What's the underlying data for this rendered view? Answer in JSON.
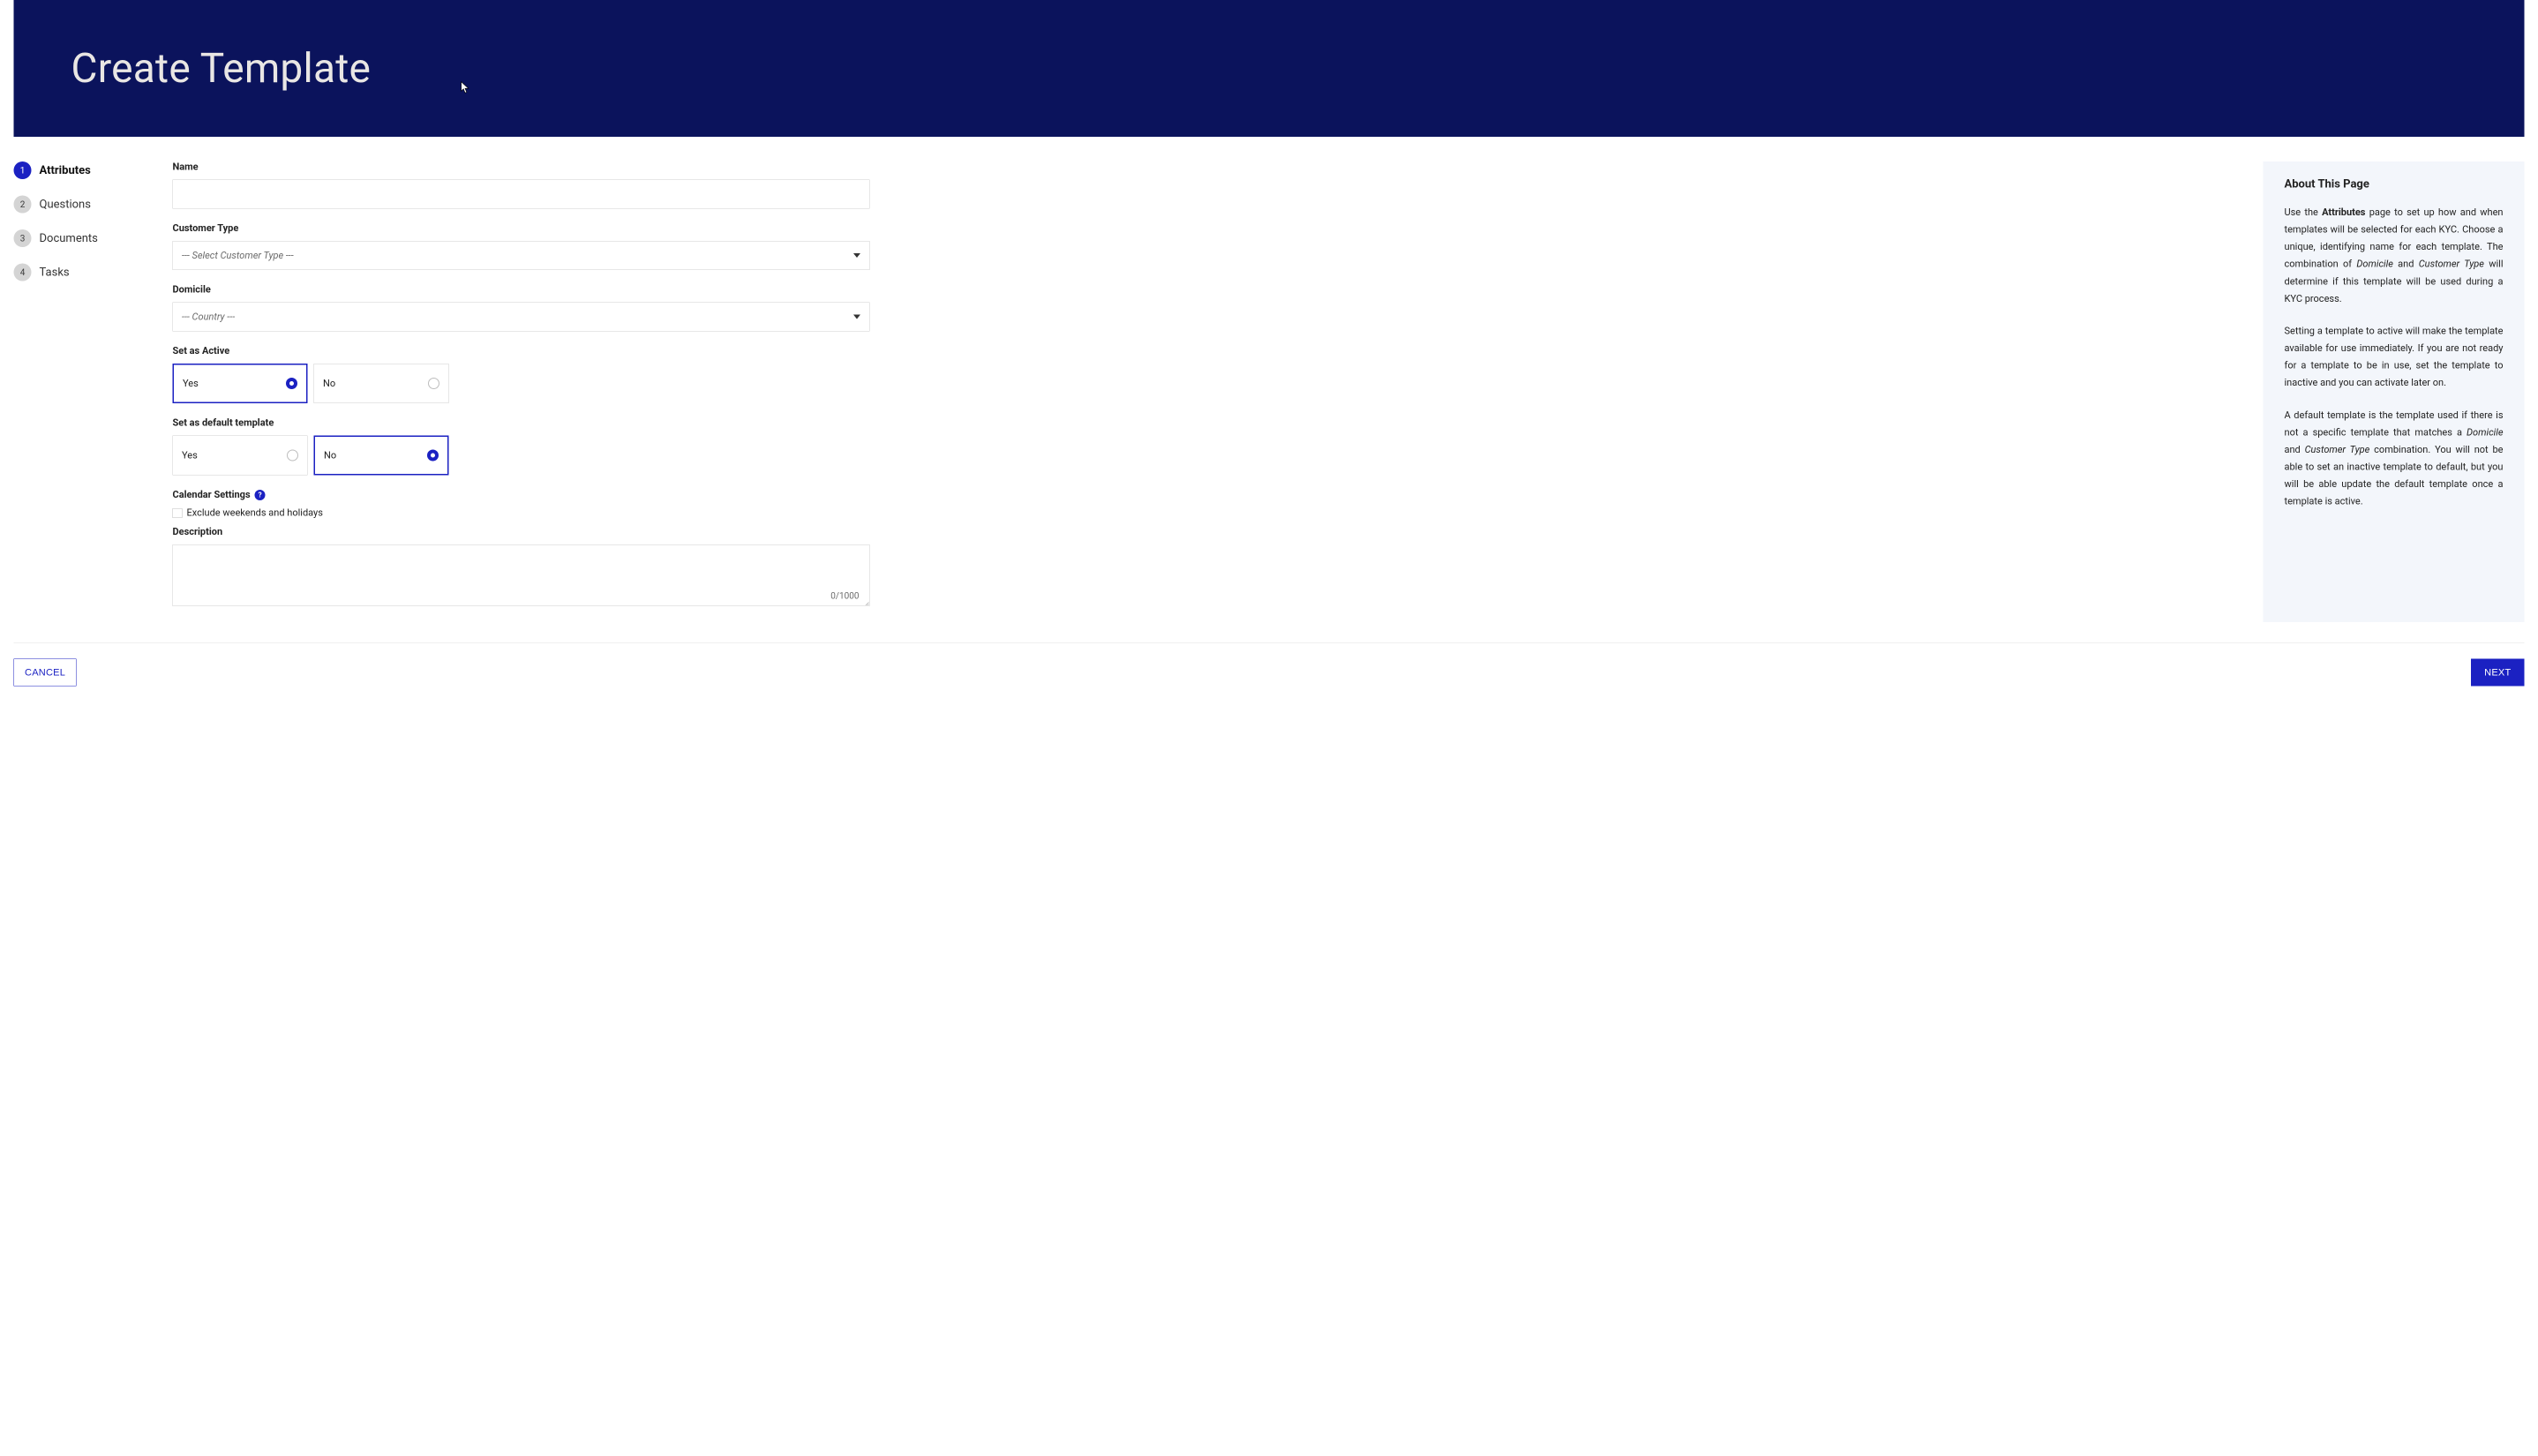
{
  "page_title": "Create Template",
  "stepper": [
    {
      "num": "1",
      "label": "Attributes",
      "active": true
    },
    {
      "num": "2",
      "label": "Questions",
      "active": false
    },
    {
      "num": "3",
      "label": "Documents",
      "active": false
    },
    {
      "num": "4",
      "label": "Tasks",
      "active": false
    }
  ],
  "form": {
    "name_label": "Name",
    "name_value": "",
    "customer_type_label": "Customer Type",
    "customer_type_placeholder": "--- Select Customer Type ---",
    "domicile_label": "Domicile",
    "domicile_placeholder": "--- Country ---",
    "set_active_label": "Set as Active",
    "set_active_options": {
      "yes": "Yes",
      "no": "No"
    },
    "set_active_value": "yes",
    "set_default_label": "Set as default template",
    "set_default_options": {
      "yes": "Yes",
      "no": "No"
    },
    "set_default_value": "no",
    "calendar_label": "Calendar Settings",
    "exclude_label": "Exclude weekends and holidays",
    "exclude_checked": false,
    "description_label": "Description",
    "description_value": "",
    "description_counter": "0/1000"
  },
  "info": {
    "title": "About This Page",
    "p1_pre": "Use the ",
    "p1_b1": "Attributes",
    "p1_mid": " page to set up how and when templates will be selected for each KYC. Choose a unique, identifying name for each template. The combination of ",
    "p1_i1": "Domicile",
    "p1_and": " and ",
    "p1_i2": "Customer Type",
    "p1_post": " will determine if this template will be used during a KYC process.",
    "p2": "Setting a template to active will make the template available for use immediately. If you are not ready for a template to be in use, set the template to inactive and you can activate later on.",
    "p3_pre": "A default template is the template used if there is not a specific template that matches a ",
    "p3_i1": "Domicile",
    "p3_and": " and ",
    "p3_i2": "Customer Type",
    "p3_post": " combination. You will not be able to set an inactive template to default, but you will be able update the default template once a template is active."
  },
  "footer": {
    "cancel": "CANCEL",
    "next": "NEXT"
  }
}
